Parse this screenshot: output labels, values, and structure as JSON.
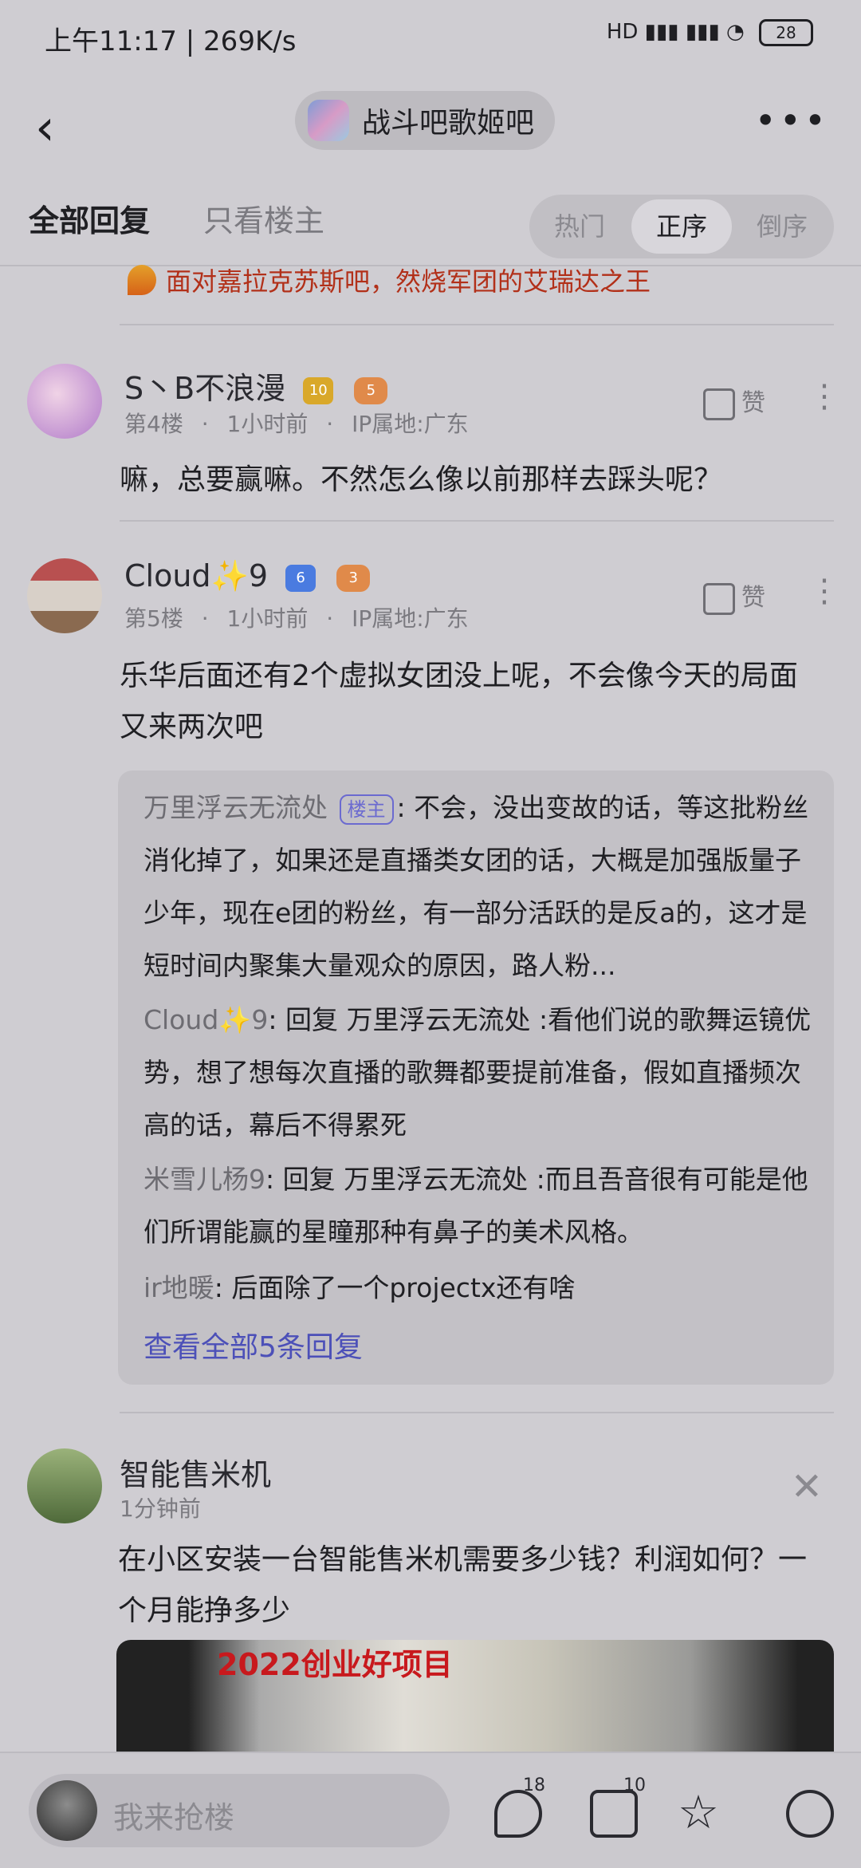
{
  "status_bar": {
    "time": "上午11:17 | 269K/s",
    "battery": "28",
    "signal": "HD"
  },
  "header": {
    "forum_name": "战斗吧歌姬吧"
  },
  "tabs": {
    "all": "全部回复",
    "owner_only": "只看楼主",
    "sort": [
      "热门",
      "正序",
      "倒序"
    ]
  },
  "ad_line": {
    "text": "面对嘉拉克苏斯吧，然烧军团的艾瑞达之王"
  },
  "posts": [
    {
      "username": "S丶B不浪漫",
      "level_badge": "10",
      "game_badge": "5",
      "floor": "第4楼",
      "time": "1小时前",
      "ip": "IP属地:广东",
      "like": "赞",
      "content": "嘛，总要赢嘛。不然怎么像以前那样去踩头呢？"
    },
    {
      "username": "Cloud✨9",
      "level_badge": "6",
      "game_badge": "3",
      "floor": "第5楼",
      "time": "1小时前",
      "ip": "IP属地:广东",
      "like": "赞",
      "content": "乐华后面还有2个虚拟女团没上呢，不会像今天的局面又来两次吧",
      "replies": [
        {
          "name": "万里浮云无流处",
          "tag": "楼主",
          "text": ": 不会，没出变故的话，等这批粉丝消化掉了，如果还是直播类女团的话，大概是加强版量子少年，现在e团的粉丝，有一部分活跃的是反a的，这才是短时间内聚集大量观众的原因，路人粉..."
        },
        {
          "name": "Cloud✨9",
          "text": ": 回复 万里浮云无流处 :看他们说的歌舞运镜优势，想了想每次直播的歌舞都要提前准备，假如直播频次高的话，幕后不得累死"
        },
        {
          "name": "米雪儿杨9",
          "text": ": 回复 万里浮云无流处 :而且吾音很有可能是他们所谓能赢的星瞳那种有鼻子的美术风格。"
        },
        {
          "name": "ir地暖",
          "text": ": 后面除了一个projectx还有啥"
        }
      ],
      "view_all": "查看全部5条回复"
    }
  ],
  "ad_post": {
    "username": "智能售米机",
    "time": "1分钟前",
    "content": "在小区安装一台智能售米机需要多少钱？利润如何？一个月能挣多少",
    "image_text": "2022创业好项目"
  },
  "bottom_bar": {
    "placeholder": "我来抢楼",
    "comments": "18",
    "likes": "10"
  }
}
